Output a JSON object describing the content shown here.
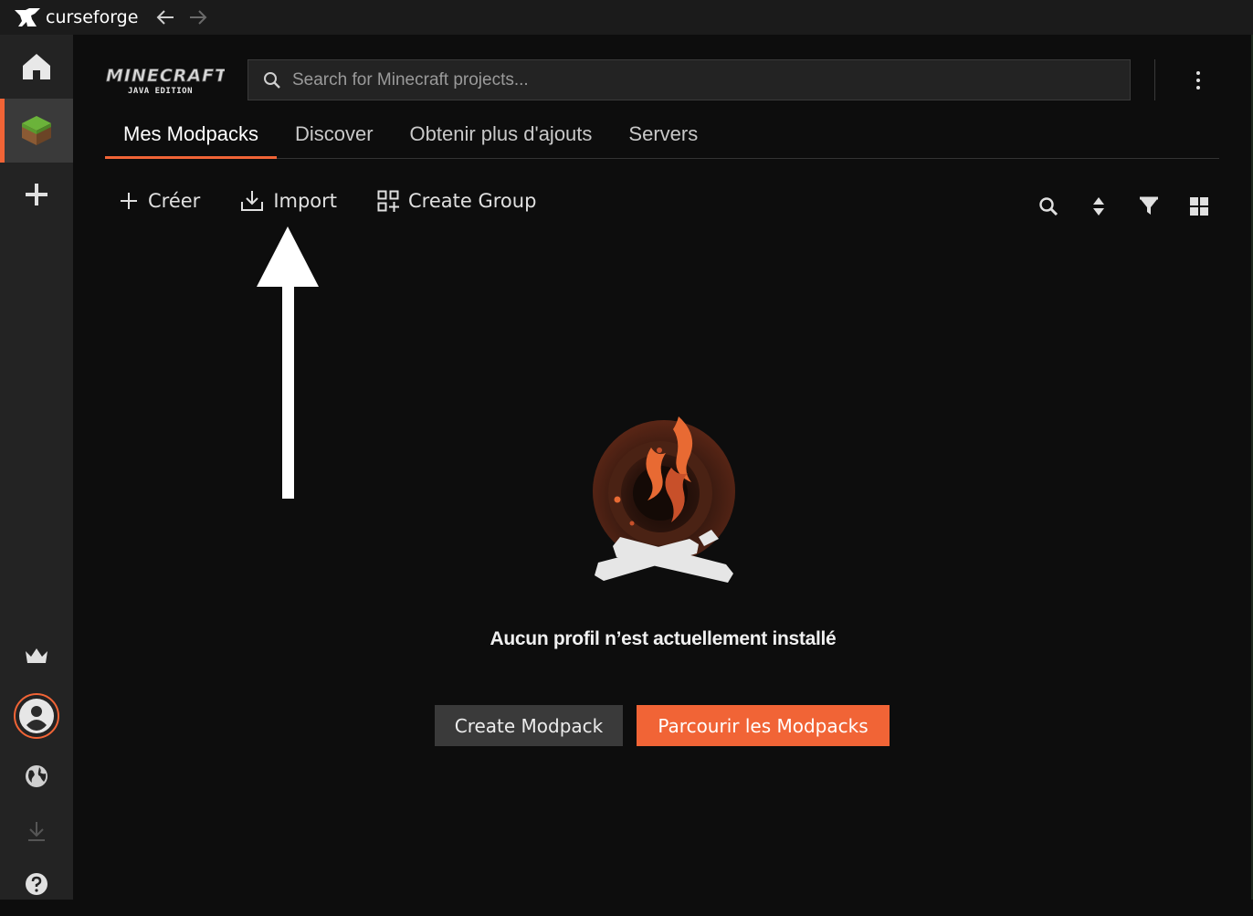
{
  "titlebar": {
    "app_name": "curseforge",
    "back_icon": "arrow-left-icon",
    "forward_icon": "arrow-right-icon"
  },
  "sidebar": {
    "items": [
      {
        "name": "home",
        "icon": "home-icon",
        "active": false
      },
      {
        "name": "minecraft",
        "icon": "minecraft-grass-block-icon",
        "active": true
      },
      {
        "name": "add-game",
        "icon": "plus-icon",
        "active": false
      }
    ],
    "bottom_items": [
      {
        "name": "premium",
        "icon": "crown-icon"
      },
      {
        "name": "profile",
        "icon": "user-avatar-icon"
      },
      {
        "name": "language",
        "icon": "globe-icon"
      },
      {
        "name": "downloads",
        "icon": "download-icon"
      },
      {
        "name": "help",
        "icon": "help-icon"
      }
    ]
  },
  "header": {
    "logo_title": "MINECRAFT",
    "logo_subtitle": "JAVA EDITION",
    "search_placeholder": "Search for Minecraft projects..."
  },
  "tabs": [
    {
      "label": "Mes Modpacks",
      "active": true
    },
    {
      "label": "Discover",
      "active": false
    },
    {
      "label": "Obtenir plus d'ajouts",
      "active": false
    },
    {
      "label": "Servers",
      "active": false
    }
  ],
  "toolbar": {
    "create_label": "Créer",
    "import_label": "Import",
    "create_group_label": "Create Group"
  },
  "view_tools": [
    "search-icon",
    "sort-icon",
    "filter-icon",
    "grid-view-icon"
  ],
  "empty_state": {
    "message": "Aucun profil n’est actuellement installé",
    "create_button": "Create Modpack",
    "browse_button": "Parcourir les Modpacks"
  },
  "colors": {
    "accent": "#f16436",
    "background": "#0d0d0d",
    "sidebar": "#232323"
  }
}
